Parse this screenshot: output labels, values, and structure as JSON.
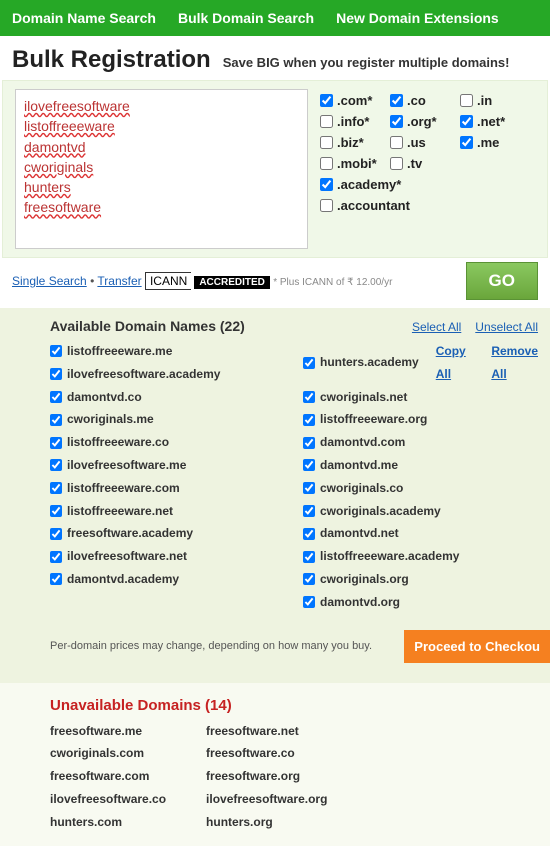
{
  "nav": {
    "items": [
      "Domain Name Search",
      "Bulk Domain Search",
      "New Domain Extensions"
    ]
  },
  "header": {
    "title": "Bulk Registration",
    "subtitle": "Save BIG when you register multiple domains!"
  },
  "input_domains": [
    "ilovefreesoftware",
    "listoffreeeware",
    "damontvd",
    "cworiginals",
    "hunters",
    "freesoftware"
  ],
  "extensions": [
    {
      "label": ".com*",
      "checked": true
    },
    {
      "label": ".co",
      "checked": true
    },
    {
      "label": ".in",
      "checked": false
    },
    {
      "label": ".info*",
      "checked": false
    },
    {
      "label": ".org*",
      "checked": true
    },
    {
      "label": ".net*",
      "checked": true
    },
    {
      "label": ".biz*",
      "checked": false
    },
    {
      "label": ".us",
      "checked": false
    },
    {
      "label": ".me",
      "checked": true
    },
    {
      "label": ".mobi*",
      "checked": false
    },
    {
      "label": ".tv",
      "checked": false
    },
    {
      "label": ".academy*",
      "checked": true,
      "wide": true
    },
    {
      "label": ".accountant",
      "checked": false,
      "wide": true
    }
  ],
  "below": {
    "single_search": "Single Search",
    "transfer": "Transfer",
    "icann_left": "ICANN",
    "icann_right": "ACCREDITED",
    "icann_note": "* Plus ICANN of ₹ 12.00/yr",
    "go": "GO"
  },
  "available": {
    "title": "Available Domain Names (22)",
    "count": 22,
    "select_all": "Select All",
    "unselect_all": "Unselect All",
    "copy_all": "Copy All",
    "remove_all": "Remove All",
    "col1": [
      "listoffreeeware.me",
      "ilovefreesoftware.academy",
      "damontvd.co",
      "cworiginals.me",
      "listoffreeeware.co",
      "ilovefreesoftware.me",
      "listoffreeeware.com",
      "listoffreeeware.net",
      "freesoftware.academy",
      "ilovefreesoftware.net",
      "damontvd.academy"
    ],
    "col2": [
      "hunters.academy",
      "cworiginals.net",
      "listoffreeeware.org",
      "damontvd.com",
      "damontvd.me",
      "cworiginals.co",
      "cworiginals.academy",
      "damontvd.net",
      "listoffreeeware.academy",
      "cworiginals.org",
      "damontvd.org"
    ]
  },
  "pricing_note": "Per-domain prices may change, depending on how many you buy.",
  "checkout": "Proceed to Checkou",
  "unavailable": {
    "title": "Unavailable Domains (14)",
    "count": 14,
    "col1": [
      "freesoftware.me",
      "cworiginals.com",
      "freesoftware.com",
      "ilovefreesoftware.co",
      "hunters.com"
    ],
    "col2": [
      "freesoftware.net",
      "freesoftware.co",
      "freesoftware.org",
      "ilovefreesoftware.org",
      "hunters.org"
    ]
  }
}
